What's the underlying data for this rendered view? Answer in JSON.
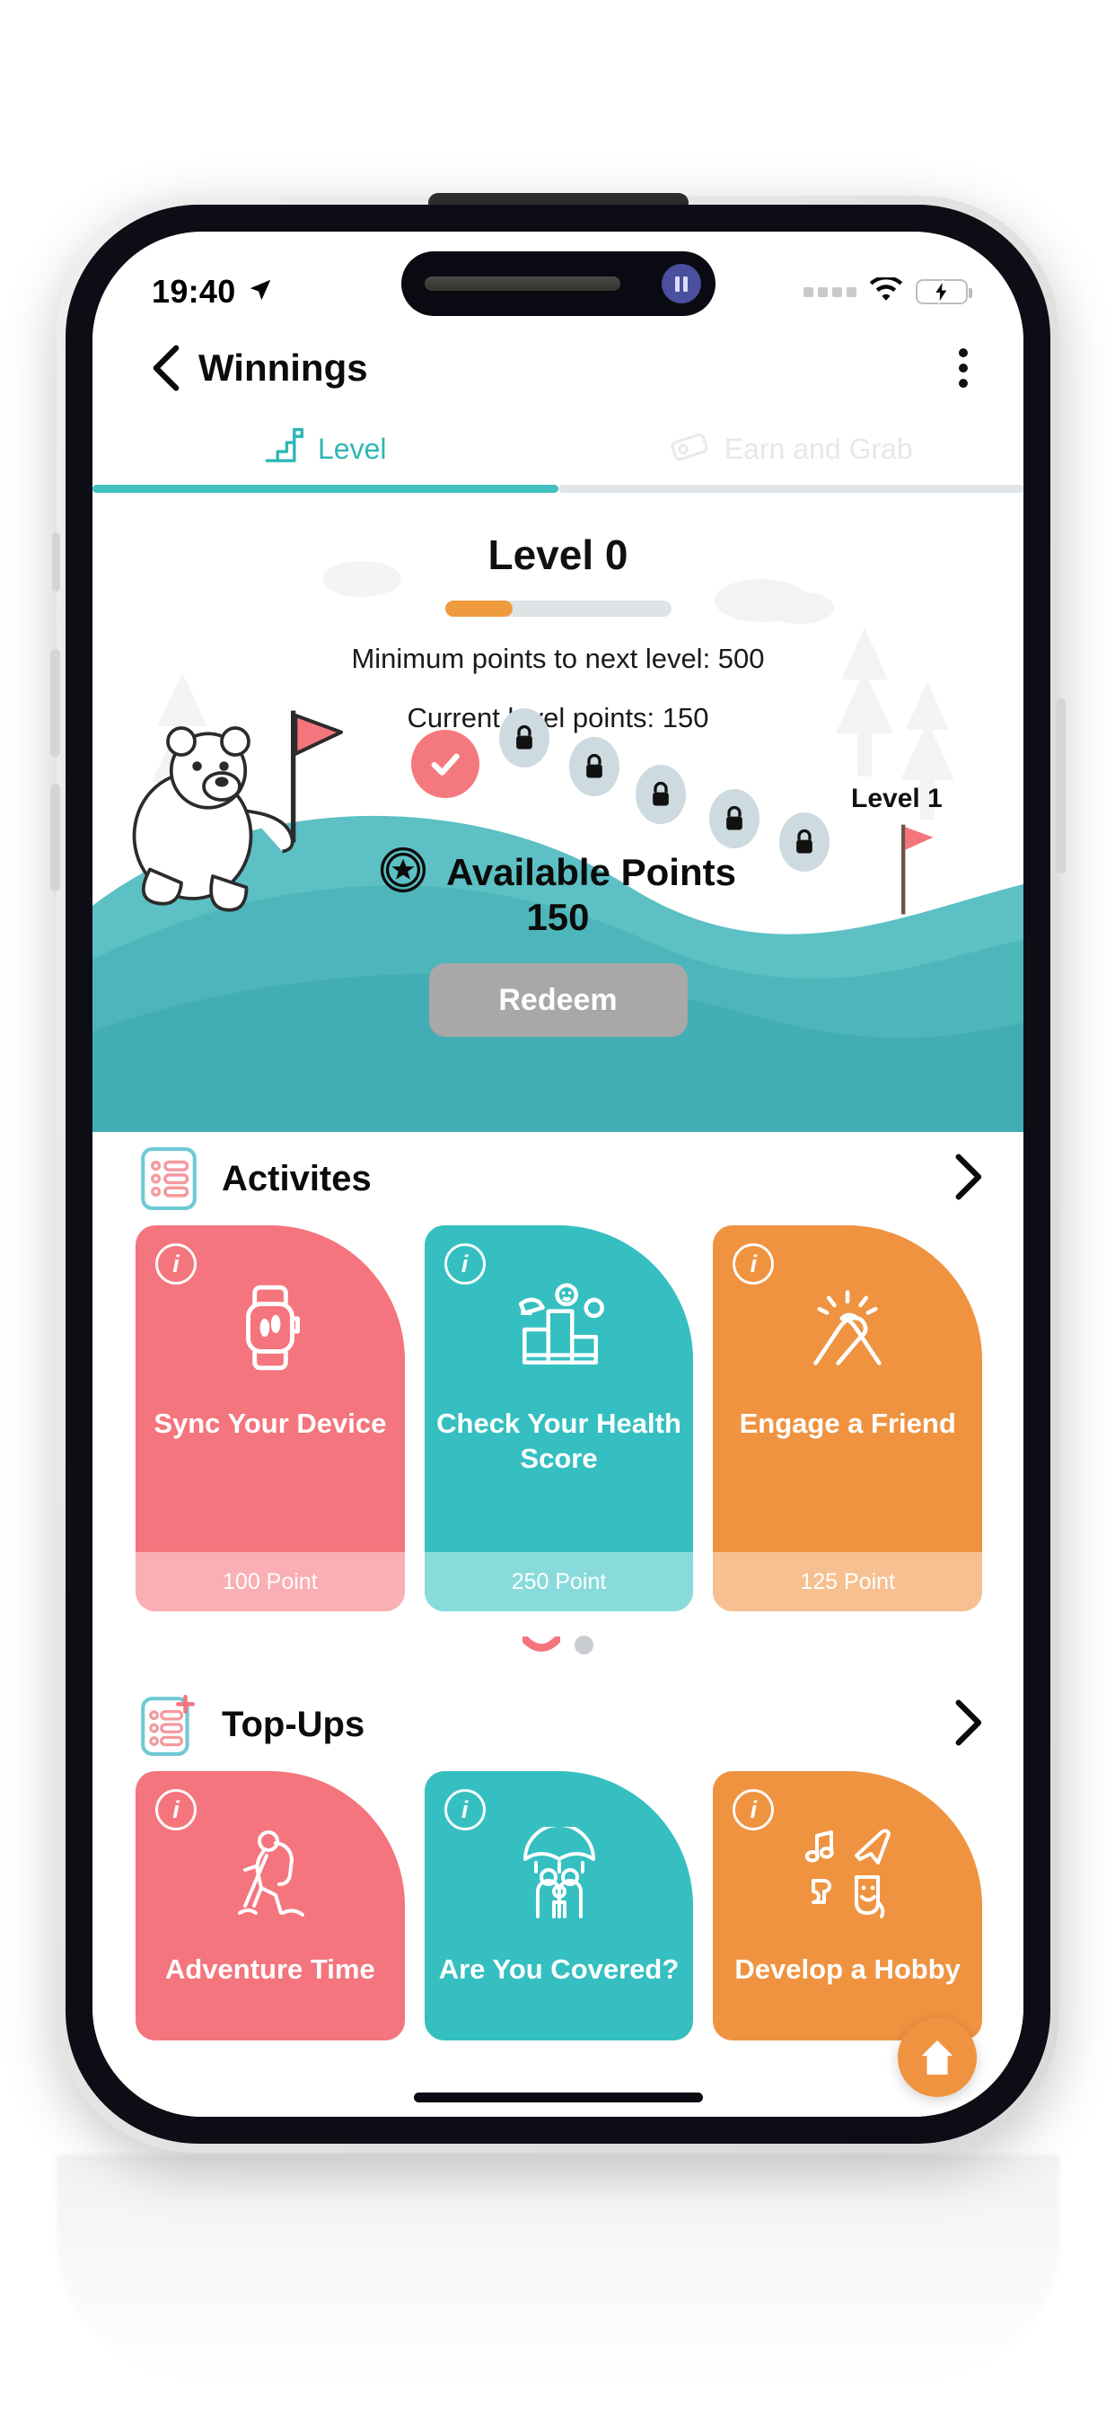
{
  "status_bar": {
    "time": "19:40",
    "location_icon": "location-arrow-icon",
    "signal_icon": "cellular-dots-icon",
    "wifi_icon": "wifi-icon",
    "battery_icon": "battery-charging-icon"
  },
  "nav": {
    "back_icon": "chevron-left-icon",
    "title": "Winnings",
    "menu_icon": "kebab-menu-icon"
  },
  "tabs": [
    {
      "label": "Level",
      "icon": "stairs-flag-icon",
      "active": true
    },
    {
      "label": "Earn and Grab",
      "icon": "ticket-icon",
      "active": false
    }
  ],
  "hero": {
    "level_title": "Level 0",
    "progress_percent": 30,
    "minimum_points_line": "Minimum points to next level: 500",
    "current_points_line": "Current level points: 150",
    "next_level_label": "Level 1",
    "available_points_label": "Available Points",
    "available_points_value": "150",
    "points_badge_icon": "star-badge-icon",
    "redeem_label": "Redeem",
    "redeem_disabled": true,
    "completed_step_icon": "check-circle-icon",
    "locked_steps": 5,
    "lock_icon": "lock-icon",
    "mascot_icon": "polar-bear-icon",
    "flag_icon": "flag-icon"
  },
  "sections": [
    {
      "title": "Activites",
      "icon": "list-checklist-icon",
      "chevron_icon": "chevron-right-icon",
      "cards": [
        {
          "title": "Sync Your Device",
          "points": "100 Point",
          "color": "#f4757d",
          "icon": "smartwatch-icon",
          "info_icon": "info-icon"
        },
        {
          "title": "Check Your Health Score",
          "points": "250 Point",
          "color": "#35bfc1",
          "icon": "health-chart-icon",
          "info_icon": "info-icon"
        },
        {
          "title": "Engage a Friend",
          "points": "125 Point",
          "color": "#ef9340",
          "icon": "handshake-icon",
          "info_icon": "info-icon"
        }
      ],
      "pagination": {
        "active_index": 0,
        "count": 2
      }
    },
    {
      "title": "Top-Ups",
      "icon": "list-plus-icon",
      "chevron_icon": "chevron-right-icon",
      "cards": [
        {
          "title": "Adventure Time",
          "points": "",
          "color": "#f4757d",
          "icon": "hiker-icon",
          "info_icon": "info-icon"
        },
        {
          "title": "Are You Covered?",
          "points": "",
          "color": "#35bfc1",
          "icon": "umbrella-family-icon",
          "info_icon": "info-icon"
        },
        {
          "title": "Develop a Hobby",
          "points": "",
          "color": "#ef9340",
          "icon": "hobby-icons",
          "info_icon": "info-icon"
        }
      ]
    }
  ],
  "home_fab": {
    "icon": "home-icon"
  },
  "colors": {
    "accent_teal": "#35bfc1",
    "accent_pink": "#f4757d",
    "accent_orange": "#ef9340",
    "progress_orange": "#f09a3e",
    "hill_teal": "#4fb9bd",
    "disabled_gray": "#a8a8a8"
  }
}
